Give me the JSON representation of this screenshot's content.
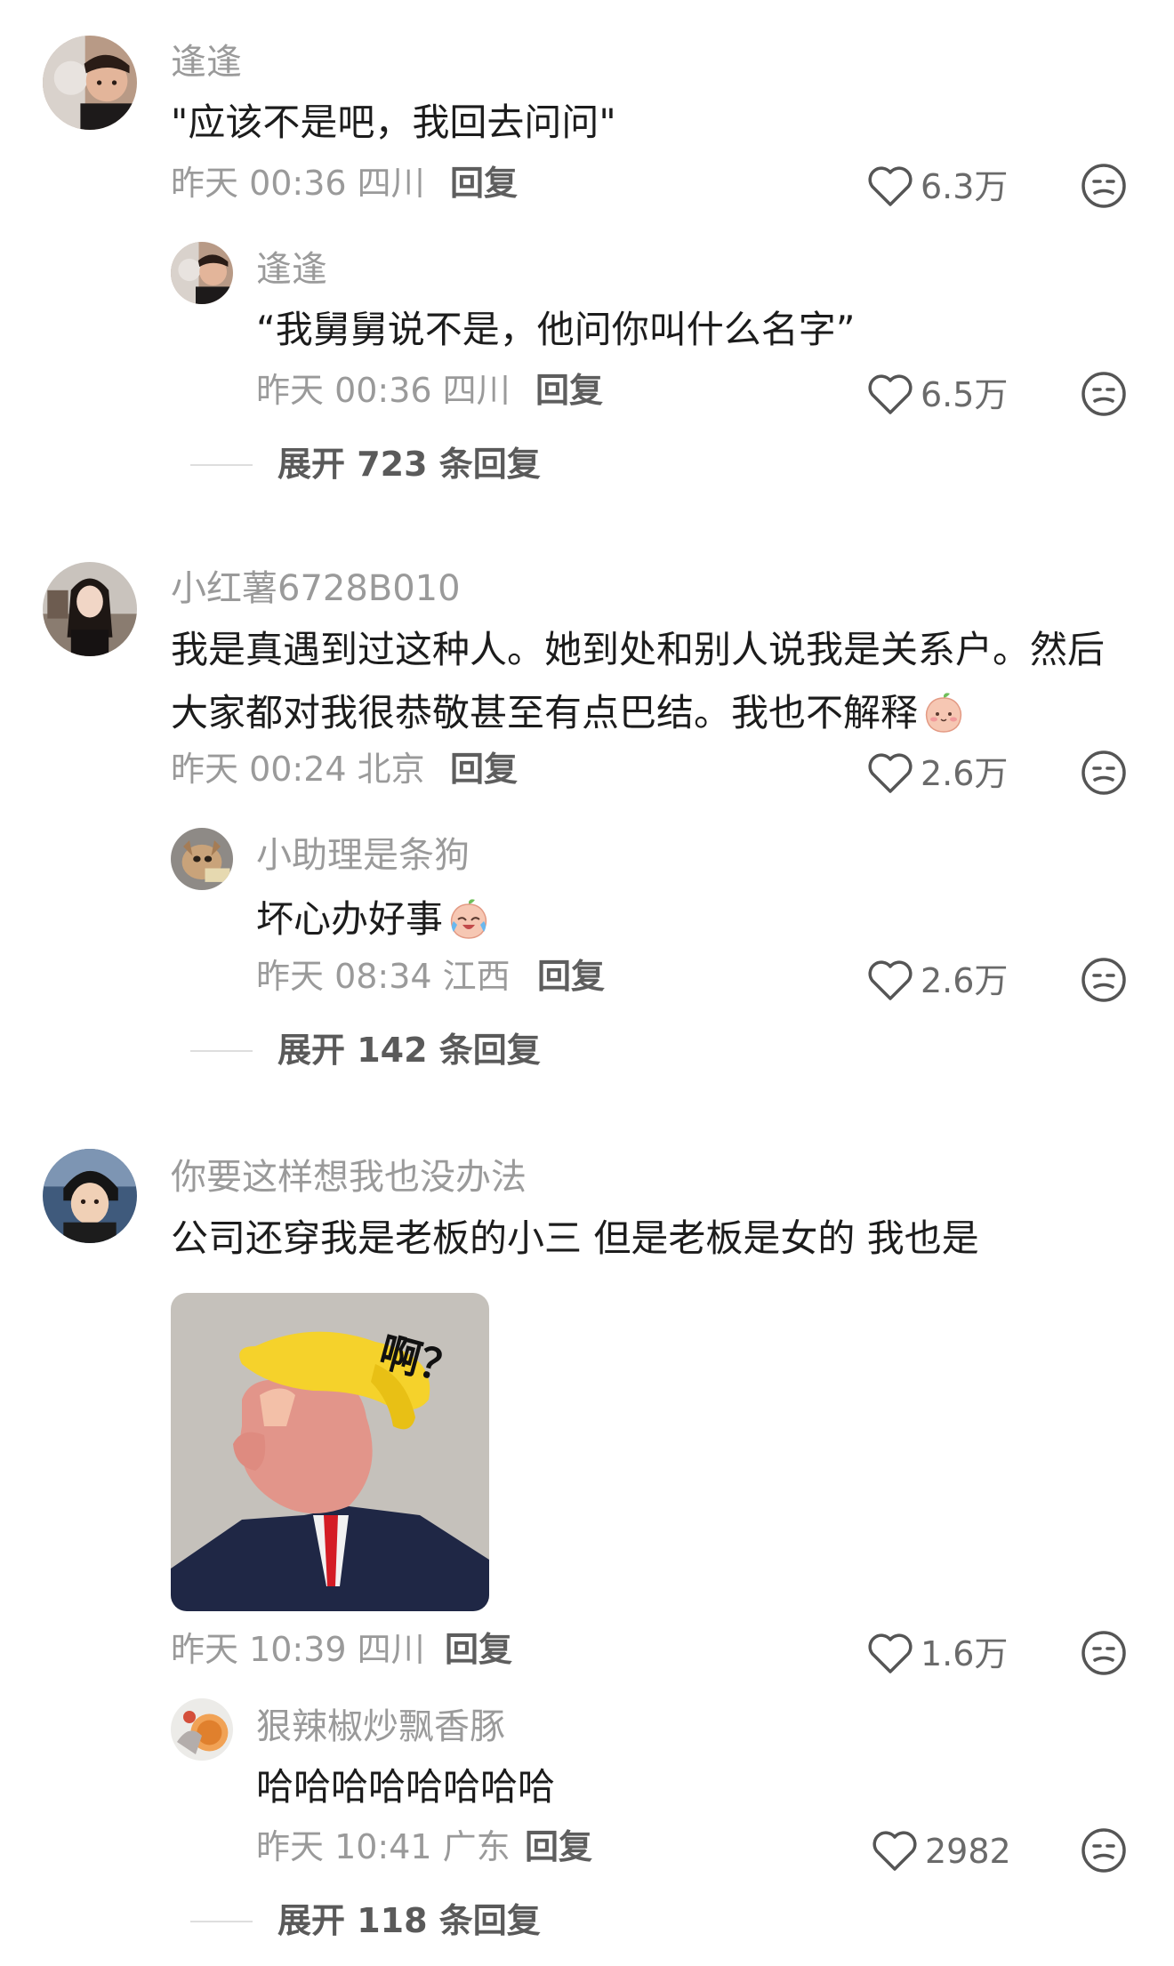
{
  "comments": [
    {
      "user": "逢逢",
      "text": "\"应该不是吧，我回去问问\"",
      "time": "昨天 00:36 四川",
      "reply_label": "回复",
      "likes": "6.3万",
      "replies": [
        {
          "user": "逢逢",
          "text": "“我舅舅说不是，他问你叫什么名字”",
          "time": "昨天 00:36 四川",
          "reply_label": "回复",
          "likes": "6.5万"
        }
      ],
      "expand": "展开 723 条回复"
    },
    {
      "user": "小红薯6728B010",
      "text_line1": "我是真遇到过这种人。她到处和别人说我是关系户。然后",
      "text_line2": "大家都对我很恭敬甚至有点巴结。我也不解释",
      "time": "昨天 00:24 北京",
      "reply_label": "回复",
      "likes": "2.6万",
      "replies": [
        {
          "user": "小助理是条狗",
          "text": "坏心办好事",
          "time": "昨天 08:34 江西",
          "reply_label": "回复",
          "likes": "2.6万"
        }
      ],
      "expand": "展开 142 条回复"
    },
    {
      "user": "你要这样想我也没办法",
      "text": "公司还穿我是老板的小三 但是老板是女的 我也是",
      "image_caption": "啊？",
      "time": "昨天 10:39 四川",
      "reply_label": "回复",
      "likes": "1.6万",
      "replies": [
        {
          "user": "狠辣椒炒飘香豚",
          "text": "哈哈哈哈哈哈哈哈",
          "time": "昨天 10:41 广东",
          "reply_label": "回复",
          "likes": "2982"
        }
      ],
      "expand": "展开 118 条回复"
    }
  ],
  "icons": {
    "like": "heart-outline-icon",
    "dislike": "meh-face-icon",
    "emoji_1": "blushing-peach-emoji",
    "emoji_2": "crying-laughing-emoji"
  },
  "colors": {
    "meta_gray": "#9a9a9a",
    "text_dark": "#1c1c1c",
    "background": "#ffffff"
  }
}
